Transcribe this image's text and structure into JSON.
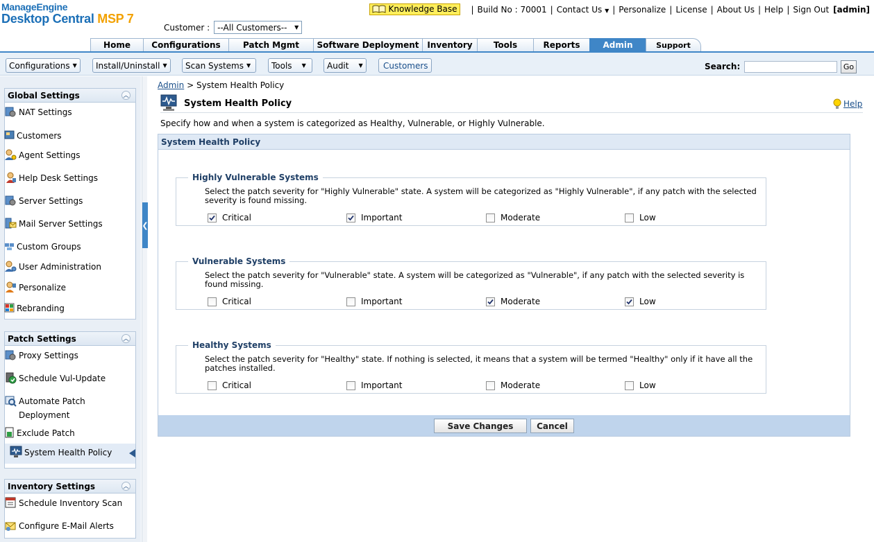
{
  "brand": {
    "line1": "ManageEngine",
    "line2": "Desktop Central",
    "line2_accent": "MSP 7"
  },
  "topnav": {
    "knowledge_base": "Knowledge Base",
    "build": "Build No : 70001",
    "contact": "Contact Us",
    "personalize": "Personalize",
    "license": "License",
    "about": "About Us",
    "help": "Help",
    "signout": "Sign Out",
    "user": "[admin]"
  },
  "customer": {
    "label": "Customer :",
    "value": "--All Customers--"
  },
  "tabs": [
    "Home",
    "Configurations",
    "Patch Mgmt",
    "Software Deployment",
    "Inventory",
    "Tools",
    "Reports",
    "Admin",
    "Support"
  ],
  "active_tab": "Admin",
  "toolbar": {
    "configurations": "Configurations",
    "install": "Install/Uninstall",
    "scan": "Scan Systems",
    "tools": "Tools",
    "audit": "Audit",
    "customers": "Customers",
    "search_label": "Search:",
    "go": "Go"
  },
  "sidebar": {
    "global": {
      "title": "Global Settings",
      "items": [
        "NAT Settings",
        "Customers",
        "Agent Settings",
        "Help Desk Settings",
        "Server Settings",
        "Mail Server Settings",
        "Custom Groups",
        "User Administration",
        "Personalize",
        "Rebranding"
      ]
    },
    "patch": {
      "title": "Patch Settings",
      "items": [
        "Proxy Settings",
        "Schedule Vul-Update",
        "Automate Patch Deployment",
        "Exclude Patch",
        "System Health Policy"
      ]
    },
    "inventory": {
      "title": "Inventory Settings",
      "items": [
        "Schedule Inventory Scan",
        "Configure E-Mail Alerts"
      ]
    }
  },
  "breadcrumb": {
    "root": "Admin",
    "sep": ">",
    "current": "System Health Policy"
  },
  "page": {
    "title": "System Health Policy",
    "help": "Help",
    "description": "Specify how and when a system is categorized as Healthy, Vulnerable, or Highly Vulnerable."
  },
  "panel": {
    "title": "System Health Policy",
    "groups": [
      {
        "title": "Highly Vulnerable Systems",
        "description": "Select the patch severity for \"Highly Vulnerable\" state. A system will be categorized as \"Highly Vulnerable\", if any patch with the selected severity is found missing.",
        "options": [
          {
            "label": "Critical",
            "checked": true
          },
          {
            "label": "Important",
            "checked": true
          },
          {
            "label": "Moderate",
            "checked": false
          },
          {
            "label": "Low",
            "checked": false
          }
        ]
      },
      {
        "title": "Vulnerable Systems",
        "description": "Select the patch severity for \"Vulnerable\" state. A system will be categorized as \"Vulnerable\", if any patch with the selected severity is found missing.",
        "options": [
          {
            "label": "Critical",
            "checked": false
          },
          {
            "label": "Important",
            "checked": false
          },
          {
            "label": "Moderate",
            "checked": true
          },
          {
            "label": "Low",
            "checked": true
          }
        ]
      },
      {
        "title": "Healthy Systems",
        "description": "Select the patch severity for \"Healthy\" state. If nothing is selected, it means that a system will be termed \"Healthy\" only if it have all the patches installed.",
        "options": [
          {
            "label": "Critical",
            "checked": false
          },
          {
            "label": "Important",
            "checked": false
          },
          {
            "label": "Moderate",
            "checked": false
          },
          {
            "label": "Low",
            "checked": false
          }
        ]
      }
    ],
    "save": "Save Changes",
    "cancel": "Cancel"
  },
  "colors": {
    "accent": "#3f86c7",
    "panel_header": "#dfe9f5",
    "button_bar": "#bfd4ec",
    "msp": "#f2a100"
  }
}
